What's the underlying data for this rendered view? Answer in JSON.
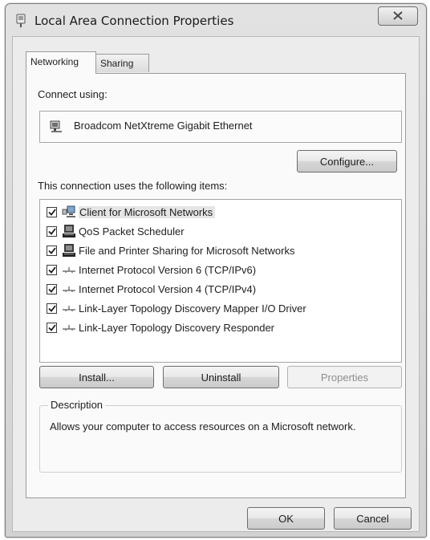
{
  "window": {
    "title": "Local Area Connection Properties",
    "icons": {
      "title": "network-adapter-icon",
      "close": "close-icon"
    }
  },
  "tabs": [
    {
      "label": "Networking",
      "active": true
    },
    {
      "label": "Sharing",
      "active": false
    }
  ],
  "networking": {
    "connect_using_label": "Connect using:",
    "adapter_name": "Broadcom NetXtreme Gigabit Ethernet",
    "adapter_icon": "network-card-icon",
    "configure_label": "Configure...",
    "items_label": "This connection uses the following items:",
    "items": [
      {
        "label": "Client for Microsoft Networks",
        "checked": true,
        "icon": "network-client-icon",
        "selected": true
      },
      {
        "label": "QoS Packet Scheduler",
        "checked": true,
        "icon": "network-service-icon",
        "selected": false
      },
      {
        "label": "File and Printer Sharing for Microsoft Networks",
        "checked": true,
        "icon": "network-service-icon",
        "selected": false
      },
      {
        "label": "Internet Protocol Version 6 (TCP/IPv6)",
        "checked": true,
        "icon": "protocol-icon",
        "selected": false
      },
      {
        "label": "Internet Protocol Version 4 (TCP/IPv4)",
        "checked": true,
        "icon": "protocol-icon",
        "selected": false
      },
      {
        "label": "Link-Layer Topology Discovery Mapper I/O Driver",
        "checked": true,
        "icon": "protocol-icon",
        "selected": false
      },
      {
        "label": "Link-Layer Topology Discovery Responder",
        "checked": true,
        "icon": "protocol-icon",
        "selected": false
      }
    ],
    "install_label": "Install...",
    "uninstall_label": "Uninstall",
    "properties_label": "Properties",
    "description_legend": "Description",
    "description_text": "Allows your computer to access resources on a Microsoft network."
  },
  "footer": {
    "ok_label": "OK",
    "cancel_label": "Cancel"
  },
  "colors": {
    "selection": "#e5e5e5",
    "disabled_text": "#8d8d8d"
  }
}
